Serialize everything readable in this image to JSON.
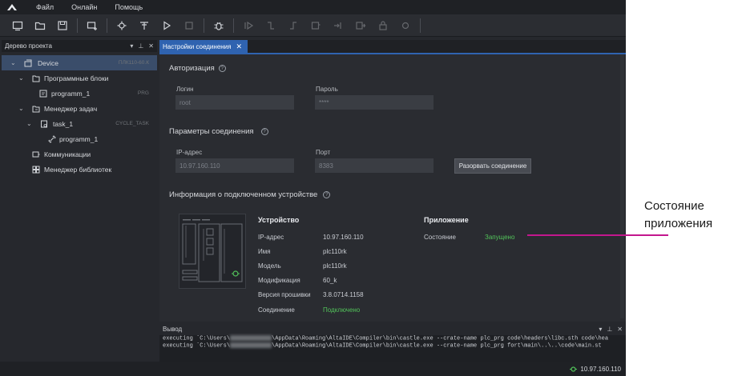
{
  "menu": {
    "file": "Файл",
    "online": "Онлайн",
    "help": "Помощь"
  },
  "toolbar": {
    "buttons": [
      "new-project-icon",
      "open-folder-icon",
      "save-icon",
      "add-device-icon",
      "build-icon",
      "compile-icon",
      "run-icon",
      "stop-icon",
      "debug-icon",
      "step-over-icon",
      "step-in-icon",
      "step-out-icon",
      "breakpoint-icon",
      "run-to-cursor-icon",
      "watch-icon",
      "lock-icon",
      "reset-icon"
    ]
  },
  "tree": {
    "title": "Дерево проекта",
    "items": [
      {
        "label": "Device",
        "tag": "ПЛК110-60.К"
      },
      {
        "label": "Программные блоки",
        "tag": ""
      },
      {
        "label": "programm_1",
        "tag": "PRG"
      },
      {
        "label": "Менеджер задач",
        "tag": ""
      },
      {
        "label": "task_1",
        "tag": "CYCLE_TASK"
      },
      {
        "label": "programm_1",
        "tag": ""
      },
      {
        "label": "Коммуникации",
        "tag": ""
      },
      {
        "label": "Менеджер библиотек",
        "tag": ""
      }
    ]
  },
  "tab": {
    "label": "Настройки соединения",
    "close": "✕"
  },
  "auth": {
    "title": "Авторизация",
    "login_label": "Логин",
    "login_value": "root",
    "password_label": "Пароль",
    "password_value": "****"
  },
  "conn": {
    "title": "Параметры соединения",
    "ip_label": "IP-адрес",
    "ip_value": "10.97.160.110",
    "port_label": "Порт",
    "port_value": "8383",
    "disconnect_label": "Разорвать соединение"
  },
  "device_info": {
    "title": "Информация о подключенном устройстве",
    "device_header": "Устройство",
    "app_header": "Приложение",
    "rows": [
      {
        "k": "IP-адрес",
        "v": "10.97.160.110"
      },
      {
        "k": "Имя",
        "v": "plc110rk"
      },
      {
        "k": "Модель",
        "v": "plc110rk"
      },
      {
        "k": "Модификация",
        "v": "60_k"
      },
      {
        "k": "Версия прошивки",
        "v": "3.8.0714.1158"
      },
      {
        "k": "Соединение",
        "v": "Подключено"
      }
    ],
    "app_state_label": "Состояние",
    "app_state_value": "Запущено"
  },
  "output": {
    "title": "Вывод",
    "line1_pre": "executing `C:\\Users\\",
    "line1_post": "\\AppData\\Roaming\\AltaIDE\\Compiler\\bin\\castle.exe --crate-name plc_prg code\\headers\\libc.sth code\\hea",
    "line2_pre": "executing `C:\\Users\\",
    "line2_post": "\\AppData\\Roaming\\AltaIDE\\Compiler\\bin\\castle.exe --crate-name plc_prg fort\\main\\..\\..\\code\\main.st"
  },
  "status": {
    "connection": "10.97.160.110"
  },
  "annotation": {
    "line1": "Состояние",
    "line2": "приложения"
  },
  "colors": {
    "accent": "#2f63b0",
    "ok": "#52c35a",
    "annotation": "#c3178d"
  }
}
